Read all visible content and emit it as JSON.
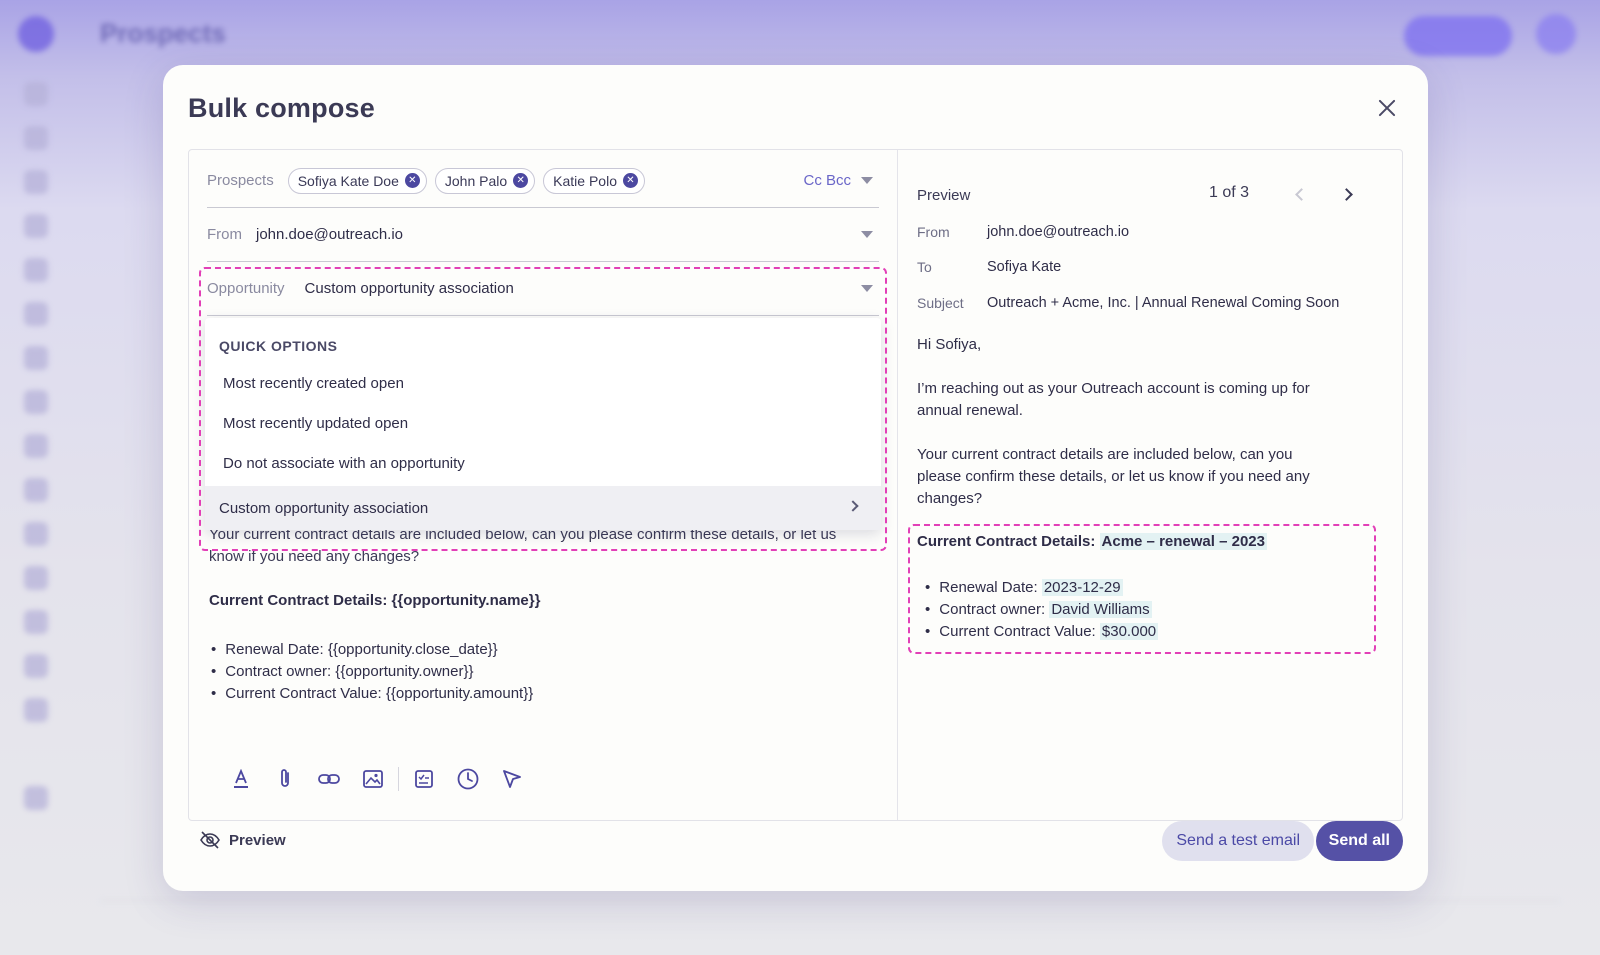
{
  "background": {
    "app_title": "Prospects"
  },
  "modal": {
    "title": "Bulk compose",
    "close_icon": "close-icon"
  },
  "compose": {
    "prospects_label": "Prospects",
    "recipients": [
      {
        "name": "Sofiya Kate Doe"
      },
      {
        "name": "John Palo"
      },
      {
        "name": "Katie Polo"
      }
    ],
    "cc_bcc": "Cc Bcc",
    "from_label": "From",
    "from_value": "john.doe@outreach.io",
    "opportunity_label": "Opportunity",
    "opportunity_value": "Custom opportunity association",
    "dropdown": {
      "section_title": "QUICK OPTIONS",
      "options": [
        "Most recently created open",
        "Most recently updated open",
        "Do not associate with an opportunity"
      ],
      "custom_option": "Custom opportunity association"
    },
    "body_partial": "Your current contract details are included below, can you please confirm these details, or let us know if you need any changes?",
    "details_heading": "Current Contract Details: {{opportunity.name}}",
    "details_list": [
      "Renewal Date: {{opportunity.close_date}}",
      "Contract owner: {{opportunity.owner}}",
      "Current Contract Value: {{opportunity.amount}}"
    ],
    "toolbar_icons": [
      "text-format-icon",
      "attachment-icon",
      "link-icon",
      "image-icon",
      "template-icon",
      "schedule-icon",
      "tracking-icon"
    ]
  },
  "preview": {
    "label": "Preview",
    "pager": "1 of 3",
    "from_label": "From",
    "from_value": "john.doe@outreach.io",
    "to_label": "To",
    "to_value": "Sofiya Kate",
    "subject_label": "Subject",
    "subject_value": "Outreach + Acme, Inc. | Annual Renewal Coming Soon",
    "greeting": "Hi Sofiya,",
    "para1": "I’m reaching out as your Outreach account is coming up for annual renewal.",
    "para2": "Your current contract details are included below, can you please confirm these details, or let us know if you need any changes?",
    "details_heading_prefix": "Current Contract Details:",
    "details_heading_value": "Acme – renewal – 2023",
    "details": [
      {
        "label": "Renewal Date:",
        "value": "2023-12-29"
      },
      {
        "label": "Contract owner:",
        "value": "David Williams"
      },
      {
        "label": "Current Contract Value:",
        "value": "$30.000"
      }
    ]
  },
  "footer": {
    "preview_toggle": "Preview",
    "send_test": "Send a test email",
    "send_all": "Send all"
  },
  "colors": {
    "accent": "#5551a6",
    "highlight_dash": "#e23fb7",
    "variable_highlight": "#e3f2f3"
  }
}
